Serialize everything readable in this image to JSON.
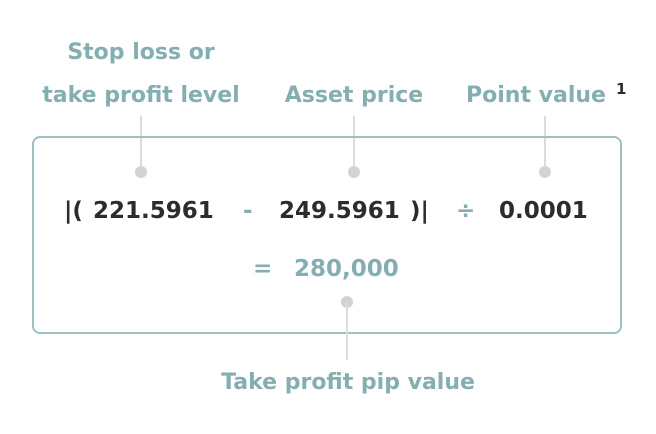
{
  "labels": {
    "stop_loss_line1": "Stop loss or",
    "stop_loss_line2": "take profit level",
    "asset_price": "Asset price",
    "point_value": "Point value",
    "footnote_marker": "1",
    "result_label": "Take profit pip value"
  },
  "formula": {
    "open": "|(",
    "level": "221.5961",
    "minus": "-",
    "price": "249.5961",
    "close": ")|",
    "divide": "÷",
    "point": "0.0001",
    "equals": "=",
    "result": "280,000"
  },
  "colors": {
    "accent": "#84aeb1",
    "border": "#9fc0c2",
    "text": "#2c2c2c",
    "connector": "#dcdcdc"
  }
}
